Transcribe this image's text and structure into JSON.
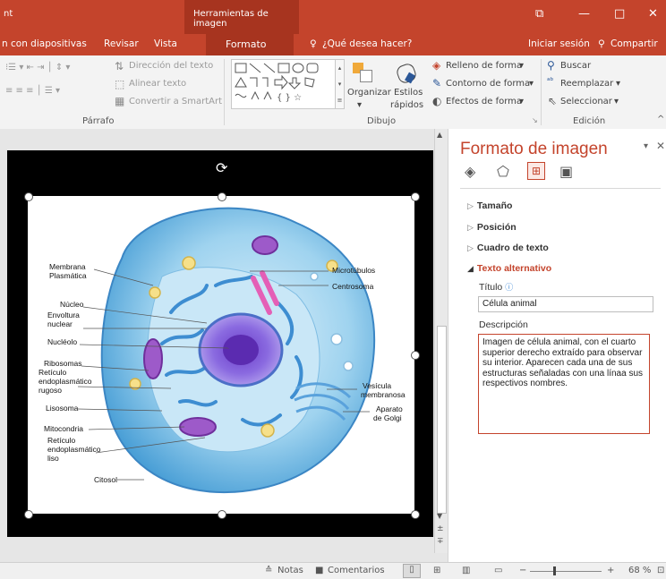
{
  "titlebar": {
    "app_fragment": "nt",
    "context_title": "Herramientas de imagen",
    "buttons": {
      "restore": "⧉",
      "minimize": "—",
      "maximize": "□",
      "close": "✕"
    }
  },
  "tabs": {
    "items": [
      "n con diapositivas",
      "Revisar",
      "Vista"
    ],
    "active": "Formato",
    "search": "¿Qué desea hacer?",
    "signin": "Iniciar sesión",
    "share": "Compartir"
  },
  "ribbon": {
    "paragraph": {
      "text_direction": "Dirección del texto",
      "align_text": "Alinear texto",
      "convert_smartart": "Convertir a SmartArt",
      "label": "Párrafo"
    },
    "drawing": {
      "arrange": "Organizar",
      "quick_styles_1": "Estilos",
      "quick_styles_2": "rápidos",
      "shape_fill": "Relleno de forma",
      "shape_outline": "Contorno de forma",
      "shape_effects": "Efectos de forma",
      "label": "Dibujo"
    },
    "editing": {
      "find": "Buscar",
      "replace": "Reemplazar",
      "select": "Seleccionar",
      "label": "Edición"
    }
  },
  "diagram": {
    "labels_left": [
      "Membrana",
      "Plasmática",
      "Núcleo",
      "Envoltura",
      "nuclear",
      "Nucléolo",
      "Ribosomas",
      "Retículo",
      "endoplasmático",
      "rugoso",
      "Lisosoma",
      "Mitocondria",
      "Retículo",
      "endoplasmático",
      "liso",
      "Citosol"
    ],
    "labels_right": [
      "Microtúbulos",
      "Centrosoma",
      "Vesícula",
      "membranosa",
      "Aparato",
      "de Golgi"
    ]
  },
  "pane": {
    "title": "Formato de imagen",
    "sections": [
      "Tamaño",
      "Posición",
      "Cuadro de texto",
      "Texto alternativo"
    ],
    "title_label": "Título",
    "title_value": "Célula animal",
    "desc_label": "Descripción",
    "desc_value": "Imagen de célula animal, con el cuarto superior derecho extraído para observar su interior. Aparecen cada una de sus estructuras señaladas con una línaa sus respectivos nombres."
  },
  "status": {
    "notes": "Notas",
    "comments": "Comentarios",
    "zoom": "68 %"
  },
  "colors": {
    "accent": "#c4442c",
    "context": "#a7341f"
  }
}
